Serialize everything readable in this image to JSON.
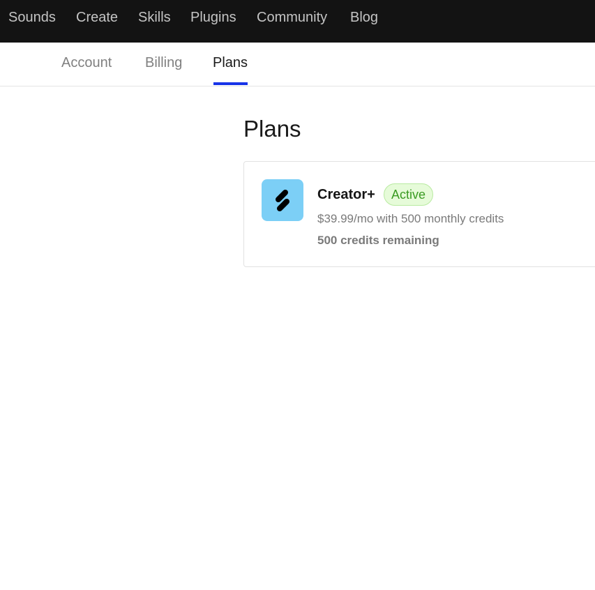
{
  "topnav": [
    "Sounds",
    "Create",
    "Skills",
    "Plugins",
    "Community",
    "Blog"
  ],
  "subnav": [
    "Account",
    "Billing",
    "Plans"
  ],
  "page_title": "Plans",
  "plan": {
    "name": "Creator+",
    "status": "Active",
    "price": "$39.99/mo with 500 monthly credits",
    "credits": "500 credits remaining"
  },
  "colors": {
    "accent": "#1733e8",
    "logo_bg": "#7ccff6",
    "badge_text": "#3a9b22"
  }
}
